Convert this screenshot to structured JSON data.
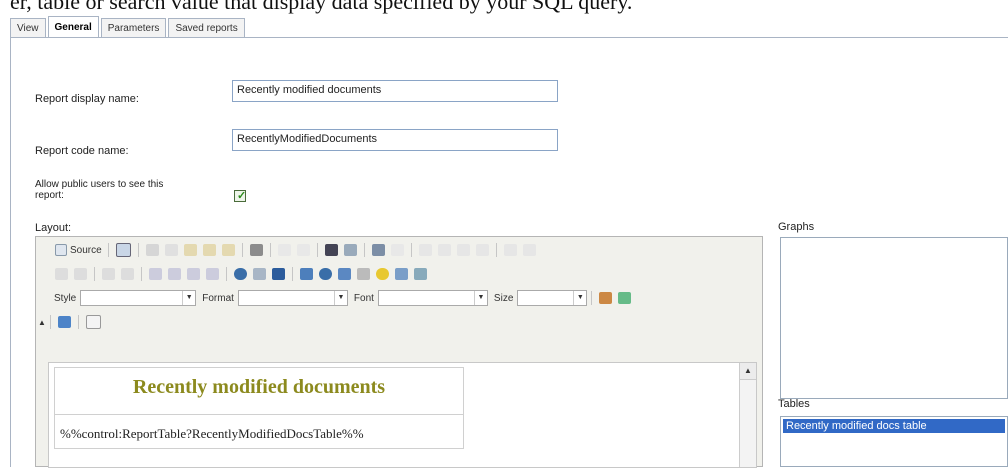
{
  "top_clip_text": "er, table or search value that display data specified by your SQL query.",
  "tabs": [
    {
      "label": "View",
      "active": false
    },
    {
      "label": "General",
      "active": true
    },
    {
      "label": "Parameters",
      "active": false
    },
    {
      "label": "Saved reports",
      "active": false
    }
  ],
  "form": {
    "display_name_label": "Report display name:",
    "display_name_value": "Recently modified documents",
    "code_name_label": "Report code name:",
    "code_name_value": "RecentlyModifiedDocuments",
    "public_label_line1": "Allow public users to see this",
    "public_label_line2": "report:",
    "public_checked": true,
    "layout_label": "Layout:"
  },
  "editor": {
    "source_label": "Source",
    "style_label": "Style",
    "format_label": "Format",
    "font_label": "Font",
    "size_label": "Size",
    "content_title": "Recently modified documents",
    "content_macro": "%%control:ReportTable?RecentlyModifiedDocsTable%%"
  },
  "graphs": {
    "label": "Graphs"
  },
  "tables": {
    "label": "Tables",
    "items": [
      "Recently modified docs table"
    ]
  }
}
